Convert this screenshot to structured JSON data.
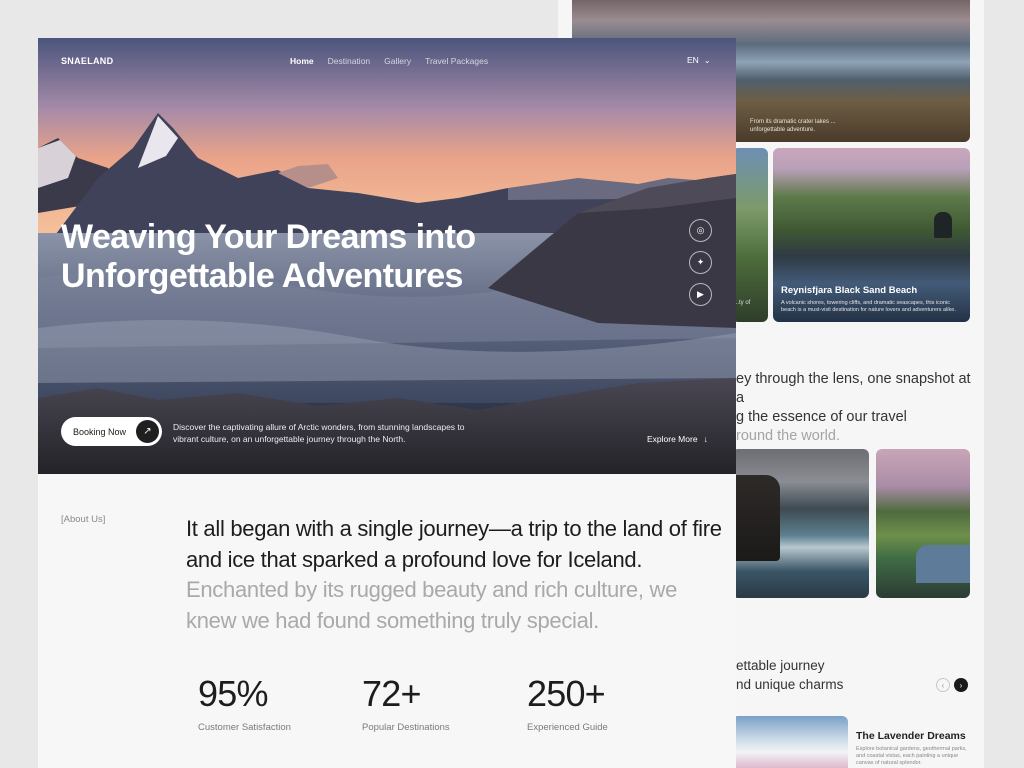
{
  "back": {
    "lake_caption": "From its dramatic crater lakes ... unforgettable adventure.",
    "cliff_caption": "...ty of",
    "beach": {
      "title": "Reynisfjara Black Sand Beach",
      "desc": "A volcanic shores, towering cliffs, and dramatic seascapes, this iconic beach is a must-visit destination for nature lovers and adventurers alike."
    },
    "lens_text": {
      "line1": "ey through the lens, one snapshot at a",
      "line2": "g the essence of our travel",
      "line3": "round the world."
    },
    "journey_text": {
      "line1": "ettable journey",
      "line2": "nd unique charms"
    },
    "carousel": {
      "prev": "‹",
      "next": "›"
    },
    "lavender": {
      "title": "The Lavender Dreams",
      "desc": "Explore botanical gardens, geothermal parks, and coastal vistas, each painting a unique canvas of natural splendor."
    }
  },
  "nav": {
    "logo": "SNAELAND",
    "links": [
      "Home",
      "Destination",
      "Gallery",
      "Travel Packages"
    ],
    "active": "Home",
    "language": "EN"
  },
  "hero": {
    "title": "Weaving Your Dreams into Unforgettable Adventures",
    "booking_label": "Booking Now",
    "description": "Discover the captivating allure of Arctic wonders, from stunning landscapes to vibrant culture, on an unforgettable journey through the North.",
    "explore_label": "Explore More"
  },
  "about": {
    "tag": "[About Us]",
    "text_dark": "It all began with a single journey—a trip to the land of fire and ice that sparked a profound love for Iceland.",
    "text_dim": "Enchanted by its rugged beauty and rich culture, we knew we had found something truly special."
  },
  "stats": [
    {
      "value": "95%",
      "label": "Customer Satisfaction"
    },
    {
      "value": "72+",
      "label": "Popular Destinations"
    },
    {
      "value": "250+",
      "label": "Experienced Guide"
    }
  ],
  "icons": {
    "instagram": "instagram-icon",
    "twitter": "twitter-icon",
    "youtube": "youtube-icon"
  }
}
